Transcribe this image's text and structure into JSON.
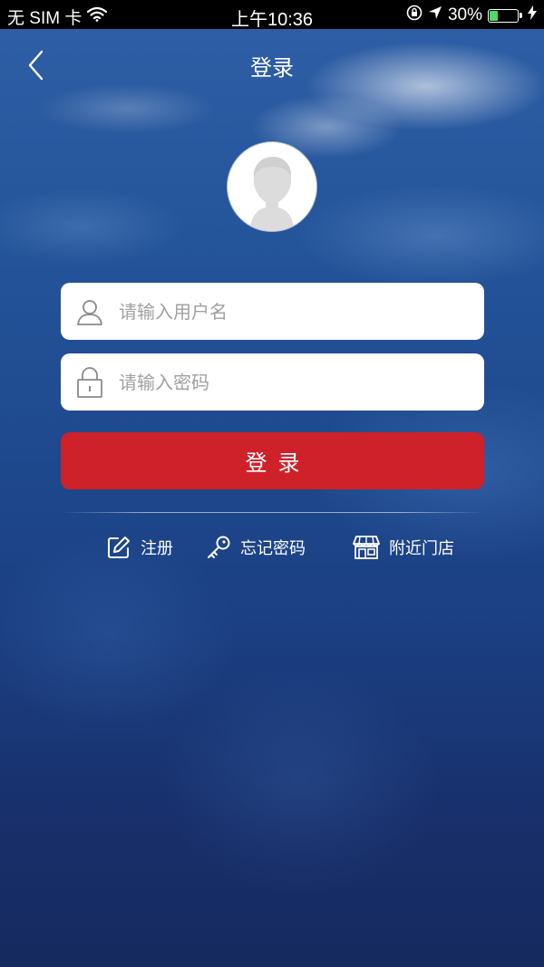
{
  "status_bar": {
    "carrier": "无 SIM 卡",
    "time": "上午10:36",
    "battery_percent": "30%",
    "battery_level": 0.3,
    "icons": [
      "wifi-icon",
      "orientation-lock-icon",
      "location-arrow-icon",
      "battery-icon",
      "charging-bolt-icon"
    ]
  },
  "nav": {
    "title": "登录",
    "back_icon": "chevron-left-icon"
  },
  "avatar": {
    "icon": "default-user-avatar-icon"
  },
  "form": {
    "username_placeholder": "请输入用户名",
    "username_value": "",
    "username_icon": "user-icon",
    "password_placeholder": "请输入密码",
    "password_value": "",
    "password_icon": "lock-icon",
    "login_label": "登录"
  },
  "links": [
    {
      "label": "注册",
      "icon": "edit-icon"
    },
    {
      "label": "忘记密码",
      "icon": "key-icon"
    },
    {
      "label": "附近门店",
      "icon": "store-icon"
    }
  ],
  "colors": {
    "primary_button": "#cf2129",
    "background_top": "#2f5fa6",
    "background_bottom": "#152a5e",
    "battery_fill": "#4cd964"
  }
}
